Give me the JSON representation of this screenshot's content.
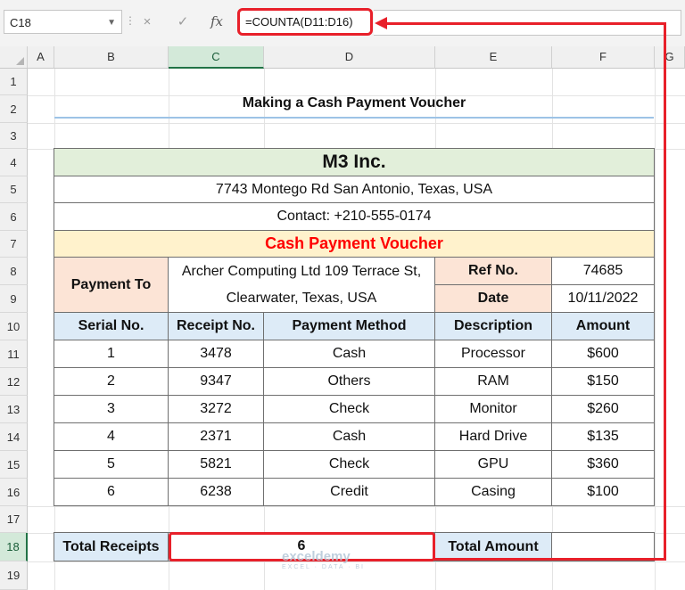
{
  "namebox": "C18",
  "formula_bar": {
    "cancel_icon": "×",
    "enter_icon": "✓",
    "fx_label": "fx",
    "formula": "=COUNTA(D11:D16)"
  },
  "columns": [
    "A",
    "B",
    "C",
    "D",
    "E",
    "F",
    "G"
  ],
  "rows": [
    "1",
    "2",
    "3",
    "4",
    "5",
    "6",
    "7",
    "8",
    "9",
    "10",
    "11",
    "12",
    "13",
    "14",
    "15",
    "16",
    "17",
    "18",
    "19"
  ],
  "sheet_title": "Making a Cash Payment Voucher",
  "voucher": {
    "company": "M3 Inc.",
    "address": "7743 Montego Rd San Antonio, Texas, USA",
    "contact": "Contact: +210-555-0174",
    "heading": "Cash Payment Voucher",
    "payment_to_label": "Payment To",
    "payee_line1": "Archer Computing Ltd 109 Terrace St,",
    "payee_line2": "Clearwater, Texas, USA",
    "ref_label": "Ref No.",
    "ref_value": "74685",
    "date_label": "Date",
    "date_value": "10/11/2022",
    "headers": [
      "Serial No.",
      "Receipt No.",
      "Payment Method",
      "Description",
      "Amount"
    ],
    "items": [
      [
        "1",
        "3478",
        "Cash",
        "Processor",
        "$600"
      ],
      [
        "2",
        "9347",
        "Others",
        "RAM",
        "$150"
      ],
      [
        "3",
        "3272",
        "Check",
        "Monitor",
        "$260"
      ],
      [
        "4",
        "2371",
        "Cash",
        "Hard Drive",
        "$135"
      ],
      [
        "5",
        "5821",
        "Check",
        "GPU",
        "$360"
      ],
      [
        "6",
        "6238",
        "Credit",
        "Casing",
        "$100"
      ]
    ],
    "total_receipts_label": "Total Receipts",
    "total_receipts_value": "6",
    "total_amount_label": "Total Amount",
    "total_amount_value": ""
  },
  "watermark": {
    "name": "exceldemy",
    "tagline": "EXCEL · DATA · BI"
  },
  "colors": {
    "highlight": "#e8202a",
    "header_green": "#e2efda",
    "peach": "#fce4d6",
    "yellow": "#fff2cc",
    "blue": "#ddebf7"
  }
}
